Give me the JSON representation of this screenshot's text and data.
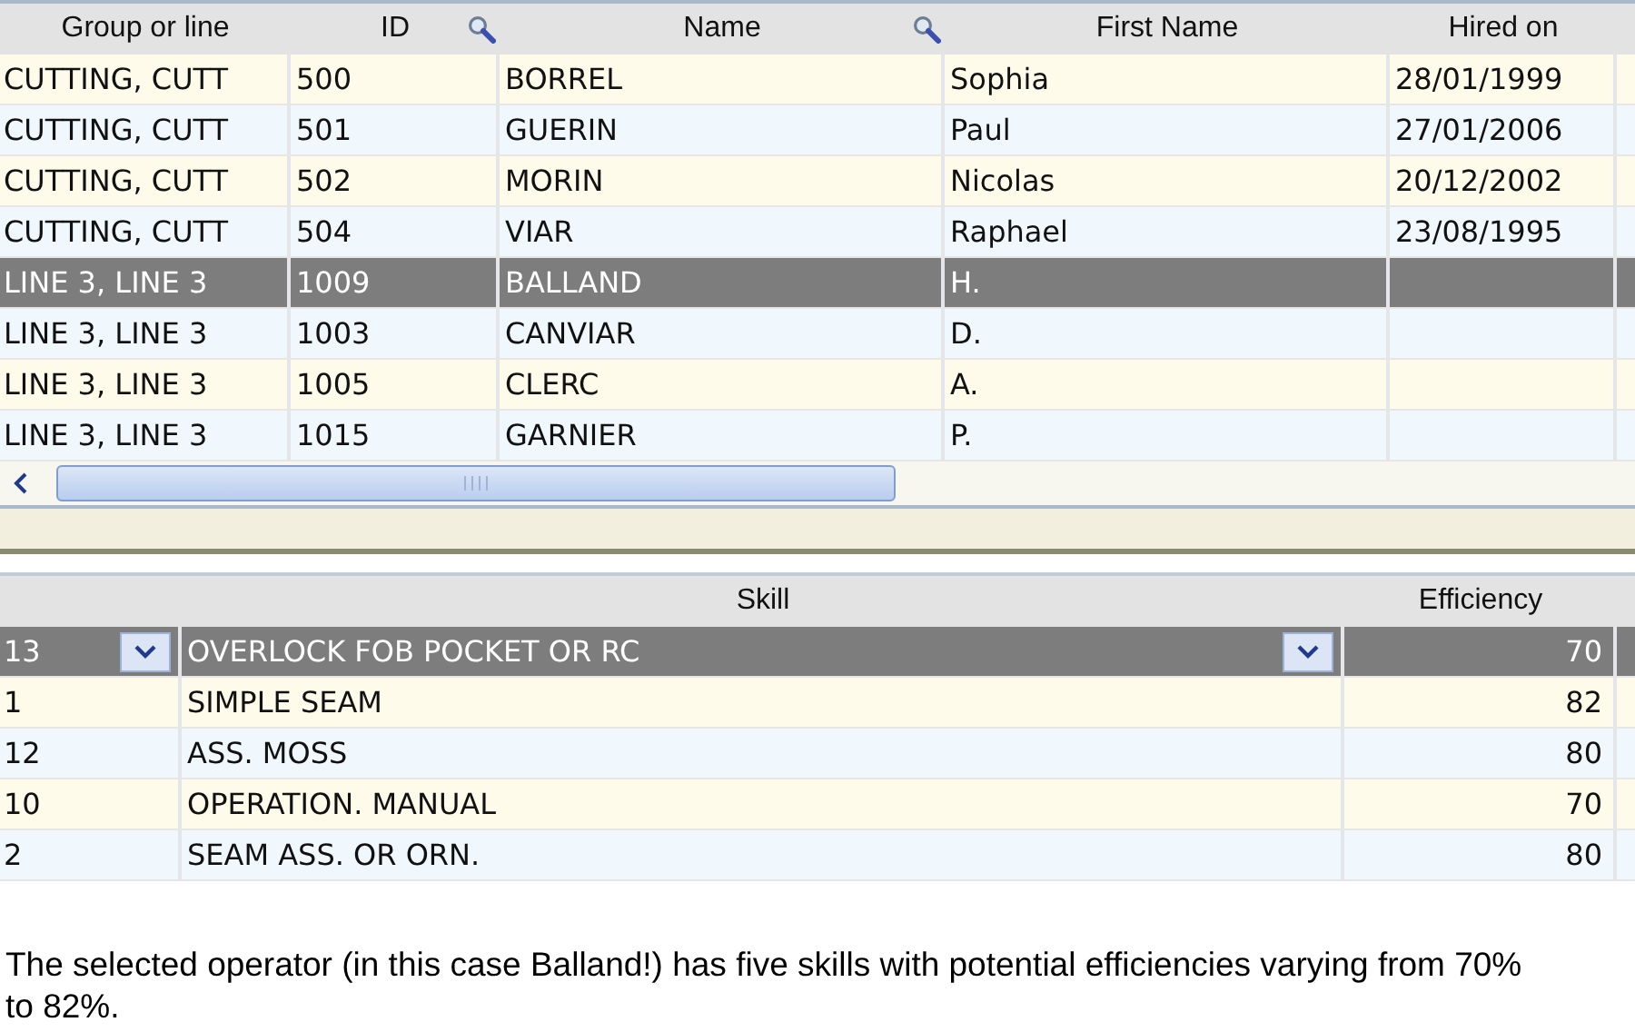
{
  "operators": {
    "columns": [
      {
        "label": "Group or line",
        "searchable": false
      },
      {
        "label": "ID",
        "searchable": true
      },
      {
        "label": "Name",
        "searchable": true
      },
      {
        "label": "First Name",
        "searchable": false
      },
      {
        "label": "Hired on",
        "searchable": false
      }
    ],
    "rows": [
      {
        "group": "CUTTING, CUTT",
        "id": "500",
        "name": "BORREL",
        "first_name": "Sophia",
        "hired_on": "28/01/1999",
        "selected": false
      },
      {
        "group": "CUTTING, CUTT",
        "id": "501",
        "name": "GUERIN",
        "first_name": "Paul",
        "hired_on": "27/01/2006",
        "selected": false
      },
      {
        "group": "CUTTING, CUTT",
        "id": "502",
        "name": "MORIN",
        "first_name": "Nicolas",
        "hired_on": "20/12/2002",
        "selected": false
      },
      {
        "group": "CUTTING, CUTT",
        "id": "504",
        "name": "VIAR",
        "first_name": "Raphael",
        "hired_on": "23/08/1995",
        "selected": false
      },
      {
        "group": "LINE 3, LINE 3",
        "id": "1009",
        "name": "BALLAND",
        "first_name": "H.",
        "selected": true
      },
      {
        "group": "LINE 3, LINE 3",
        "id": "1003",
        "name": "CANVIAR",
        "first_name": "D.",
        "selected": false
      },
      {
        "group": "LINE 3, LINE 3",
        "id": "1005",
        "name": "CLERC",
        "first_name": "A.",
        "selected": false
      },
      {
        "group": "LINE 3, LINE 3",
        "id": "1015",
        "name": "GARNIER",
        "first_name": "P.",
        "selected": false
      }
    ]
  },
  "skills": {
    "columns": [
      {
        "label": "Skill"
      },
      {
        "label": "Efficiency"
      }
    ],
    "rows": [
      {
        "code": "13",
        "skill": "OVERLOCK FOB POCKET OR RC",
        "efficiency": "70",
        "selected": true
      },
      {
        "code": "1",
        "skill": "SIMPLE SEAM",
        "efficiency": "82",
        "selected": false
      },
      {
        "code": "12",
        "skill": "ASS. MOSS",
        "efficiency": "80",
        "selected": false
      },
      {
        "code": "10",
        "skill": "OPERATION. MANUAL",
        "efficiency": "70",
        "selected": false
      },
      {
        "code": "2",
        "skill": "SEAM ASS. OR ORN.",
        "efficiency": "80",
        "selected": false
      }
    ]
  },
  "caption": "The selected operator (in this case Balland!) has five skills with potential efficiencies varying from 70% to 82%."
}
